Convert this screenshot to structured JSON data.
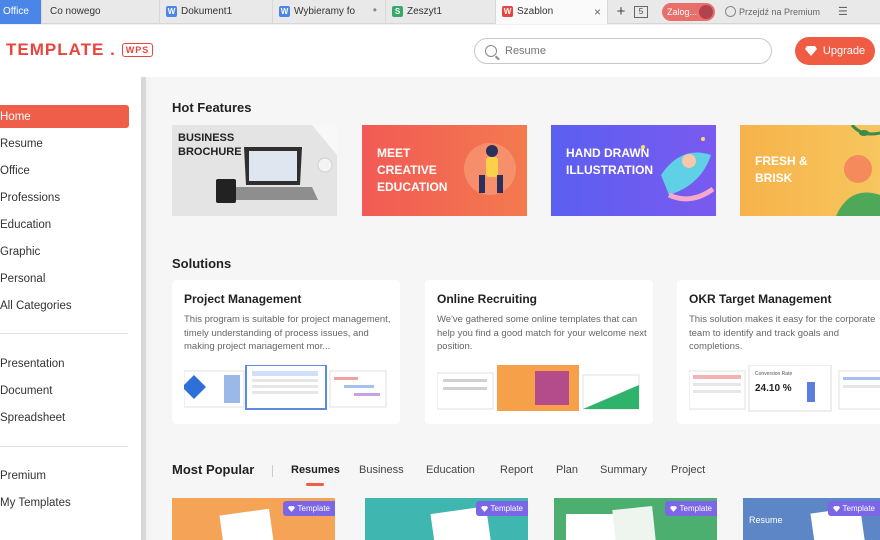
{
  "tabs": [
    {
      "label": "Office"
    },
    {
      "label": "Co nowego"
    },
    {
      "label": "Dokument1"
    },
    {
      "label": "Wybieramy fo"
    },
    {
      "label": "Zeszyt1"
    },
    {
      "label": "Szablon"
    }
  ],
  "tab_plus": "+",
  "tab_count": "5",
  "login_label": "Zalog...",
  "premium_link": "Przejdź na Premium",
  "logo": {
    "text": "TEMPLATE .",
    "badge": "WPS"
  },
  "search": {
    "placeholder": "Resume"
  },
  "upgrade_label": "Upgrade",
  "sidebar": {
    "items": [
      "Home",
      "Resume",
      "Office",
      "Professions",
      "Education",
      "Graphic",
      "Personal",
      "All Categories"
    ],
    "items2": [
      "Presentation",
      "Document",
      "Spreadsheet"
    ],
    "items3": [
      "Premium",
      "My Templates"
    ]
  },
  "hot_features": {
    "title": "Hot Features",
    "cards": [
      "BUSINESS BROCHURE",
      "MEET CREATIVE EDUCATION",
      "HAND DRAWN ILLUSTRATION",
      "FRESH & BRISK"
    ]
  },
  "solutions": {
    "title": "Solutions",
    "cards": [
      {
        "title": "Project Management",
        "desc": "This program is suitable for project management, timely understanding of process issues, and making project management mor..."
      },
      {
        "title": "Online Recruiting",
        "desc": "We've gathered some online templates that can help you find a good match for your welcome next position."
      },
      {
        "title": "OKR Target Management",
        "desc": "This solution makes it easy for the corporate team to identify and track goals and completions."
      }
    ]
  },
  "okr_chart": {
    "label": "Conversion Rate",
    "value": "24.10 %"
  },
  "most_popular": {
    "title": "Most Popular",
    "tabs": [
      "Resumes",
      "Business",
      "Education",
      "Report",
      "Plan",
      "Summary",
      "Project"
    ],
    "badge": "Template",
    "card4_text": "Resume"
  },
  "colors": {
    "accent": "#ef5e49",
    "badge": "#7b66e8"
  }
}
